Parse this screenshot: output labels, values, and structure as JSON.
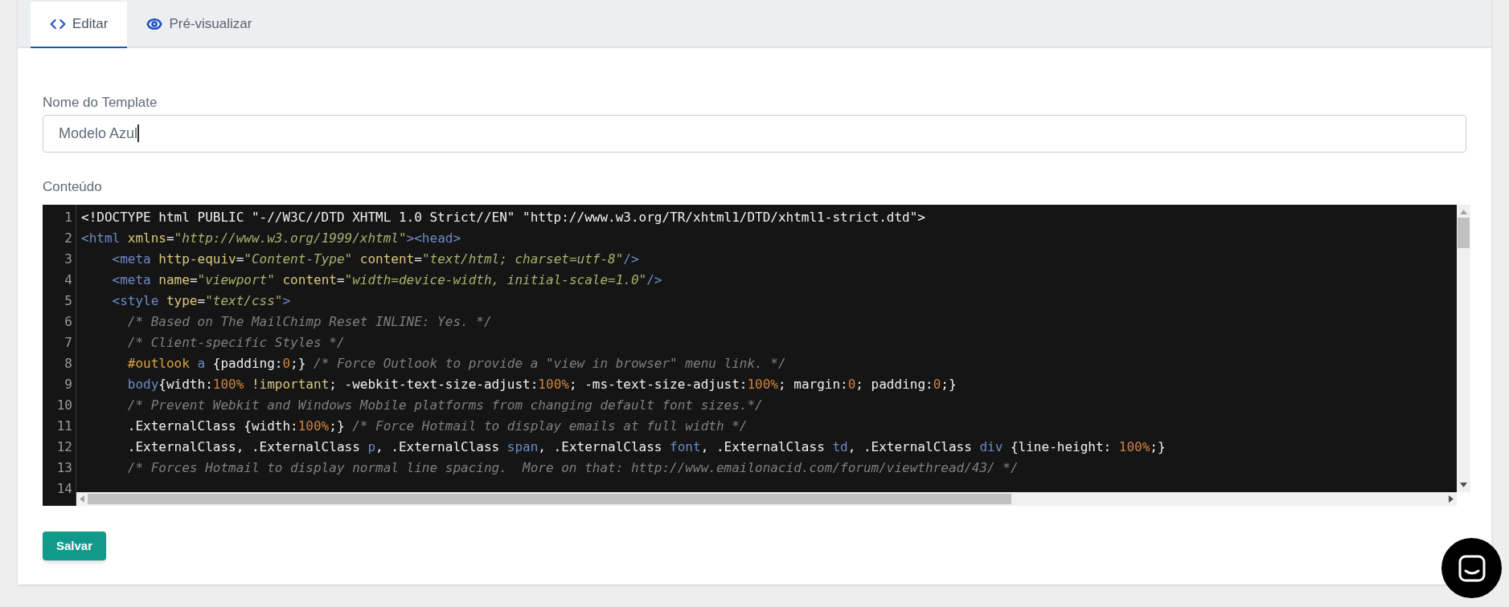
{
  "tabs": [
    {
      "label": "Editar",
      "kind": "code",
      "selected": true
    },
    {
      "label": "Pré-visualizar",
      "kind": "eye",
      "selected": false
    }
  ],
  "form": {
    "name_label": "Nome do Template",
    "name_value": "Modelo Azul",
    "content_label": "Conteúdo"
  },
  "editor": {
    "lines": [
      {
        "number": "1",
        "tokens": [
          {
            "kind": "plain",
            "text": "<!DOCTYPE html PUBLIC \"-//W3C//DTD XHTML 1.0 Strict//EN\" \"http://www.w3.org/TR/xhtml1/DTD/xhtml1-strict.dtd\">"
          }
        ]
      },
      {
        "number": "2",
        "tokens": [
          {
            "kind": "tag",
            "text": "<html"
          },
          {
            "kind": "attr",
            "text": " xmlns"
          },
          {
            "kind": "plain",
            "text": "="
          },
          {
            "kind": "string",
            "text": "\"http://www.w3.org/1999/xhtml\""
          },
          {
            "kind": "tag",
            "text": "><head>"
          }
        ]
      },
      {
        "number": "3",
        "tokens": [
          {
            "kind": "tag",
            "text": "    <meta"
          },
          {
            "kind": "attr",
            "text": " http-equiv"
          },
          {
            "kind": "plain",
            "text": "="
          },
          {
            "kind": "string",
            "text": "\"Content-Type\""
          },
          {
            "kind": "attr",
            "text": " content"
          },
          {
            "kind": "plain",
            "text": "="
          },
          {
            "kind": "string",
            "text": "\"text/html; charset=utf-8\""
          },
          {
            "kind": "tag",
            "text": "/>"
          }
        ]
      },
      {
        "number": "4",
        "tokens": [
          {
            "kind": "tag",
            "text": "    <meta"
          },
          {
            "kind": "attr",
            "text": " name"
          },
          {
            "kind": "plain",
            "text": "="
          },
          {
            "kind": "string",
            "text": "\"viewport\""
          },
          {
            "kind": "attr",
            "text": " content"
          },
          {
            "kind": "plain",
            "text": "="
          },
          {
            "kind": "string",
            "text": "\"width=device-width, initial-scale=1.0\""
          },
          {
            "kind": "tag",
            "text": "/>"
          }
        ]
      },
      {
        "number": "5",
        "tokens": [
          {
            "kind": "tag",
            "text": "    <style"
          },
          {
            "kind": "attr",
            "text": " type"
          },
          {
            "kind": "plain",
            "text": "="
          },
          {
            "kind": "string",
            "text": "\"text/css\""
          },
          {
            "kind": "tag",
            "text": ">"
          }
        ]
      },
      {
        "number": "6",
        "tokens": [
          {
            "kind": "comment",
            "text": "      /* Based on The MailChimp Reset INLINE: Yes. */"
          }
        ]
      },
      {
        "number": "7",
        "tokens": [
          {
            "kind": "comment",
            "text": "      /* Client-specific Styles */"
          }
        ]
      },
      {
        "number": "8",
        "tokens": [
          {
            "kind": "selector",
            "text": "      #outlook"
          },
          {
            "kind": "keyword",
            "text": " a"
          },
          {
            "kind": "plain",
            "text": " {padding:"
          },
          {
            "kind": "number",
            "text": "0"
          },
          {
            "kind": "plain",
            "text": ";}"
          },
          {
            "kind": "comment",
            "text": " /* Force Outlook to provide a \"view in browser\" menu link. */"
          }
        ]
      },
      {
        "number": "9",
        "tokens": [
          {
            "kind": "keyword",
            "text": "      body"
          },
          {
            "kind": "plain",
            "text": "{width:"
          },
          {
            "kind": "number",
            "text": "100%"
          },
          {
            "kind": "important",
            "text": " !important"
          },
          {
            "kind": "plain",
            "text": "; -webkit-text-size-adjust:"
          },
          {
            "kind": "number",
            "text": "100%"
          },
          {
            "kind": "plain",
            "text": "; -ms-text-size-adjust:"
          },
          {
            "kind": "number",
            "text": "100%"
          },
          {
            "kind": "plain",
            "text": "; margin:"
          },
          {
            "kind": "number",
            "text": "0"
          },
          {
            "kind": "plain",
            "text": "; padding:"
          },
          {
            "kind": "number",
            "text": "0"
          },
          {
            "kind": "plain",
            "text": ";}"
          }
        ]
      },
      {
        "number": "10",
        "tokens": [
          {
            "kind": "comment",
            "text": "      /* Prevent Webkit and Windows Mobile platforms from changing default font sizes.*/"
          }
        ]
      },
      {
        "number": "11",
        "tokens": [
          {
            "kind": "plain",
            "text": "      .ExternalClass {width:"
          },
          {
            "kind": "number",
            "text": "100%"
          },
          {
            "kind": "plain",
            "text": ";}"
          },
          {
            "kind": "comment",
            "text": " /* Force Hotmail to display emails at full width */"
          }
        ]
      },
      {
        "number": "12",
        "tokens": [
          {
            "kind": "plain",
            "text": "      .ExternalClass, .ExternalClass"
          },
          {
            "kind": "keyword",
            "text": " p"
          },
          {
            "kind": "plain",
            "text": ", .ExternalClass"
          },
          {
            "kind": "keyword",
            "text": " span"
          },
          {
            "kind": "plain",
            "text": ", .ExternalClass"
          },
          {
            "kind": "keyword",
            "text": " font"
          },
          {
            "kind": "plain",
            "text": ", .ExternalClass"
          },
          {
            "kind": "keyword",
            "text": " td"
          },
          {
            "kind": "plain",
            "text": ", .ExternalClass"
          },
          {
            "kind": "keyword",
            "text": " div"
          },
          {
            "kind": "plain",
            "text": " {line-height: "
          },
          {
            "kind": "number",
            "text": "100%"
          },
          {
            "kind": "plain",
            "text": ";}"
          }
        ]
      },
      {
        "number": "13",
        "tokens": [
          {
            "kind": "comment",
            "text": "      /* Forces Hotmail to display normal line spacing.  More on that: http://www.emailonacid.com/forum/viewthread/43/ */"
          }
        ]
      },
      {
        "number": "14"
      }
    ]
  },
  "save_button": "Salvar"
}
